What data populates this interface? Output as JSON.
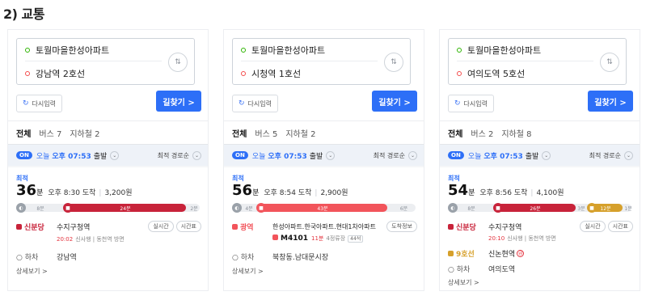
{
  "heading": "2) 교통",
  "panels": [
    {
      "origin": "토월마을한성아파트",
      "destination": "강남역 2호선",
      "reset": "다시입력",
      "find": "길찾기 >",
      "tabs": [
        "전체",
        "버스 7",
        "지하철 2"
      ],
      "on": "ON",
      "today": "오늘",
      "time": "오후 07:53",
      "depart": "출발",
      "sort": "최적 경로순",
      "best": "최적",
      "duration": "36",
      "unit": "분",
      "arrive": "오후 8:30 도착",
      "fare": "3,200원",
      "bar": {
        "walk1": "8분",
        "ride": "24분",
        "walk2": "2분",
        "color": "#c8233a"
      },
      "step1": {
        "type": "신분당",
        "stop": "수지구청역",
        "p1": "실시간",
        "p2": "시간표",
        "next": "20:02",
        "dir": "신사행 | 동천역 방면",
        "color": "#c8233a"
      },
      "drop": {
        "label": "하차",
        "stop": "강남역"
      },
      "more": "상세보기 >"
    },
    {
      "origin": "토월마을한성아파트",
      "destination": "시청역 1호선",
      "reset": "다시입력",
      "find": "길찾기 >",
      "tabs": [
        "전체",
        "버스 5",
        "지하철 2"
      ],
      "on": "ON",
      "today": "오늘",
      "time": "오후 07:53",
      "depart": "출발",
      "sort": "최적 경로순",
      "best": "최적",
      "duration": "56",
      "unit": "분",
      "arrive": "오후 8:54 도착",
      "fare": "2,900원",
      "bar": {
        "walk1": "4분",
        "ride": "43분",
        "walk2": "6분",
        "color": "#f2545b"
      },
      "step1": {
        "type": "광역",
        "stop": "한성아파트.한국아파트.현대1차아파트",
        "p1": "도착정보",
        "busno": "M4101",
        "min": "11분",
        "info": "4정류장",
        "tag": "44석",
        "color": "#f2545b"
      },
      "drop": {
        "label": "하차",
        "stop": "북창동.남대문시장"
      },
      "more": "상세보기 >"
    },
    {
      "origin": "토월마을한성아파트",
      "destination": "여의도역 5호선",
      "reset": "다시입력",
      "find": "길찾기 >",
      "tabs": [
        "전체",
        "버스 2",
        "지하철 8"
      ],
      "on": "ON",
      "today": "오늘",
      "time": "오후 07:53",
      "depart": "출발",
      "sort": "최적 경로순",
      "best": "최적",
      "duration": "54",
      "unit": "분",
      "arrive": "오후 8:56 도착",
      "fare": "4,100원",
      "bar": {
        "walk1": "8분",
        "ride": "26분",
        "walk2": "3분",
        "ride2": "12분",
        "walk3": "1분",
        "color": "#c8233a",
        "color2": "#d6a02b"
      },
      "step1": {
        "type": "신분당",
        "stop": "수지구청역",
        "p1": "실시간",
        "p2": "시간표",
        "next": "20:10",
        "dir": "신사행 | 동천역 방면",
        "color": "#c8233a"
      },
      "step2": {
        "type": "9호선",
        "stop": "신논현역",
        "circle": "급",
        "color": "#d6a02b"
      },
      "drop": {
        "label": "하차",
        "stop": "여의도역"
      },
      "more": "상세보기 >"
    }
  ]
}
